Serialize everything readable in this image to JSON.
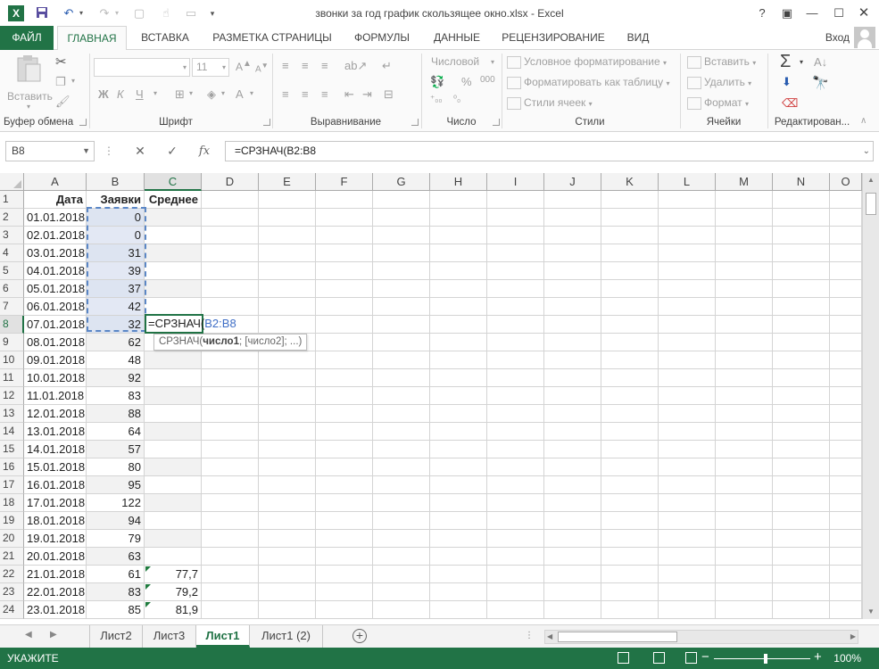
{
  "window": {
    "title": "звонки за год график скользящее окно.xlsx - Excel",
    "app_icon": "X"
  },
  "ribbon_tabs": [
    "ФАЙЛ",
    "ГЛАВНАЯ",
    "ВСТАВКА",
    "РАЗМЕТКА СТРАНИЦЫ",
    "ФОРМУЛЫ",
    "ДАННЫЕ",
    "РЕЦЕНЗИРОВАНИЕ",
    "ВИД"
  ],
  "signin": "Вход",
  "ribbon": {
    "paste": "Вставить",
    "groups": [
      "Буфер обмена",
      "Шрифт",
      "Выравнивание",
      "Число",
      "Стили",
      "Ячейки",
      "Редактирован..."
    ],
    "font_size": "11",
    "bold": "Ж",
    "italic": "К",
    "underline": "Ч",
    "number_format": "Числовой",
    "conditional_formatting": "Условное форматирование",
    "format_as_table": "Форматировать как таблицу",
    "cell_styles": "Стили ячеек",
    "insert": "Вставить",
    "delete": "Удалить",
    "format": "Формат",
    "percent": "%",
    "thousands": "000"
  },
  "formula_bar": {
    "name_box": "B8",
    "fx": "fx",
    "formula": "=СРЗНАЧ(B2:B8"
  },
  "columns": [
    "A",
    "B",
    "C",
    "D",
    "E",
    "F",
    "G",
    "H",
    "I",
    "J",
    "K",
    "L",
    "M",
    "N",
    "O"
  ],
  "rows": {
    "numbers": [
      "1",
      "2",
      "3",
      "4",
      "5",
      "6",
      "7",
      "8",
      "9",
      "10",
      "11",
      "12",
      "13",
      "14",
      "15",
      "16",
      "17",
      "18",
      "19",
      "20",
      "21",
      "22",
      "23",
      "24"
    ],
    "header": [
      "Дата",
      "Заявки",
      "Среднее"
    ],
    "dates": [
      "01.01.2018",
      "02.01.2018",
      "03.01.2018",
      "04.01.2018",
      "05.01.2018",
      "06.01.2018",
      "07.01.2018",
      "08.01.2018",
      "09.01.2018",
      "10.01.2018",
      "11.01.2018",
      "12.01.2018",
      "13.01.2018",
      "14.01.2018",
      "15.01.2018",
      "16.01.2018",
      "17.01.2018",
      "18.01.2018",
      "19.01.2018",
      "20.01.2018",
      "21.01.2018",
      "22.01.2018",
      "23.01.2018"
    ],
    "values": [
      "0",
      "0",
      "31",
      "39",
      "37",
      "42",
      "32",
      "62",
      "48",
      "92",
      "83",
      "88",
      "64",
      "57",
      "80",
      "95",
      "122",
      "94",
      "79",
      "63",
      "61",
      "83",
      "85"
    ],
    "averages": [
      "77,7",
      "79,2",
      "81,9"
    ]
  },
  "edit": {
    "func": "=СРЗНАЧ(",
    "ref": "B2:B8",
    "tooltip_func": "СРЗНАЧ(",
    "tooltip_arg1": "число1",
    "tooltip_rest": "; [число2]; ...)"
  },
  "sheets": [
    "Лист2",
    "Лист3",
    "Лист1",
    "Лист1 (2)"
  ],
  "active_sheet": "Лист1",
  "status": {
    "mode": "УКАЖИТЕ",
    "zoom": "100%"
  },
  "colors": {
    "accent": "#217346",
    "range_ref": "#3f6ec6"
  }
}
